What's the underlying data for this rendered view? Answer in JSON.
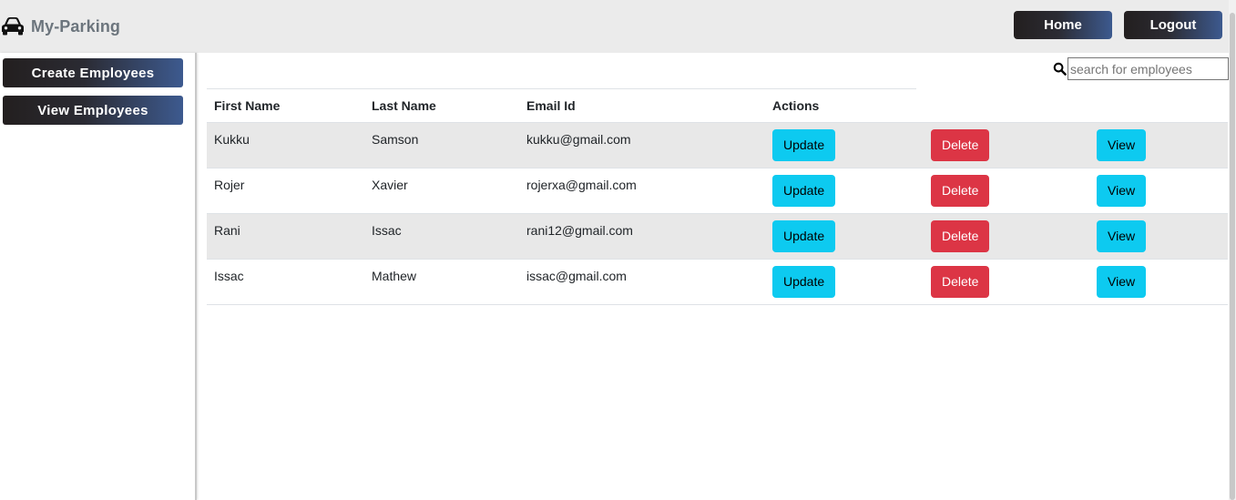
{
  "brand": {
    "name": "My-Parking",
    "icon": "car-icon"
  },
  "nav": {
    "home_label": "Home",
    "logout_label": "Logout"
  },
  "sidebar": {
    "create_label": "Create Employees",
    "view_label": "View Employees"
  },
  "search": {
    "placeholder": "search for employees",
    "value": "",
    "icon": "search-icon"
  },
  "table": {
    "headers": [
      "First Name",
      "Last Name",
      "Email Id",
      "Actions"
    ],
    "action_labels": {
      "update": "Update",
      "delete": "Delete",
      "view": "View"
    },
    "rows": [
      {
        "first_name": "Kukku",
        "last_name": "Samson",
        "email": "kukku@gmail.com"
      },
      {
        "first_name": "Rojer",
        "last_name": "Xavier",
        "email": "rojerxa@gmail.com"
      },
      {
        "first_name": "Rani",
        "last_name": "Issac",
        "email": "rani12@gmail.com"
      },
      {
        "first_name": "Issac",
        "last_name": "Mathew",
        "email": "issac@gmail.com"
      }
    ]
  },
  "colors": {
    "accent_info": "#0dcaf0",
    "accent_danger": "#dc3545",
    "nav_bg": "#ebebeb",
    "gradient_start": "#231f1f",
    "gradient_end": "#3d5a8f"
  }
}
